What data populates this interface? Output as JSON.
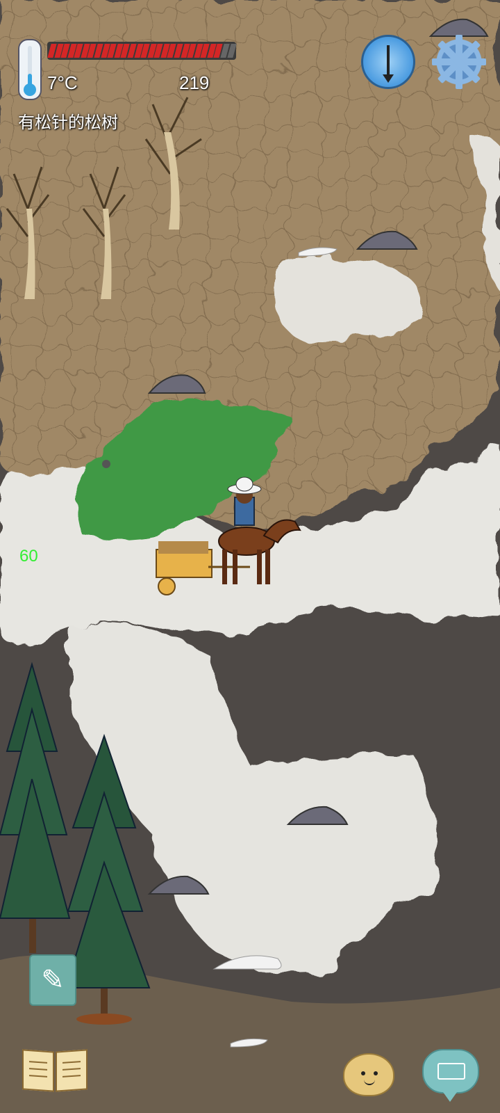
{
  "hud": {
    "temperature": "7°C",
    "counter": "219",
    "hovered_object": "有松针的松树",
    "fps": "60",
    "health_fraction": 0.93
  },
  "icons": {
    "thermometer": "thermometer-icon",
    "compass": "compass-icon",
    "settings": "gear-icon",
    "edit": "pencil-icon",
    "journal": "open-book-icon",
    "emote": "potato-face-icon",
    "chat": "keyboard-chat-icon"
  },
  "colors": {
    "health_fill": "#d42626",
    "health_empty": "#666666",
    "thermo_fill": "#38a5e0",
    "fps_text": "#33ee33",
    "snow": "#e7e6e1",
    "dirt": "#9b8463",
    "grass": "#3f9944",
    "dark_ground": "#4c4744"
  }
}
